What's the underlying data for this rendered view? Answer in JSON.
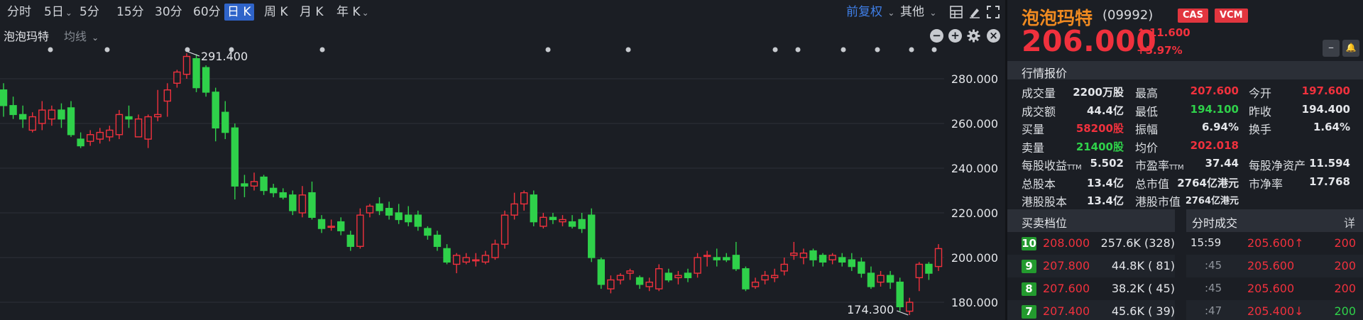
{
  "period_tabs": [
    {
      "label": "分时",
      "caret": ""
    },
    {
      "label": "5日",
      "caret": "⌄"
    },
    {
      "label": "5分",
      "caret": ""
    },
    {
      "label": "15分",
      "caret": ""
    },
    {
      "label": "30分",
      "caret": ""
    },
    {
      "label": "60分",
      "caret": ""
    },
    {
      "label": "日 K",
      "caret": ""
    },
    {
      "label": "周 K",
      "caret": ""
    },
    {
      "label": "月 K",
      "caret": ""
    },
    {
      "label": "年 K",
      "caret": "⌄"
    }
  ],
  "active_tab": "日 K",
  "adjust_label": "前复权",
  "other_label": "其他",
  "chart_stock_name": "泡泡玛特",
  "ma_label": "均线",
  "chart_controls": {
    "minus": "−",
    "plus": "+",
    "close": "×"
  },
  "colors": {
    "up": "#f0313d",
    "down": "#2fd14a",
    "accent": "#2f64c9",
    "name": "#f08a20",
    "background": "#1b1e24"
  },
  "chart_data": {
    "type": "candlestick",
    "y_ticks": [
      "280.000",
      "260.000",
      "240.000",
      "220.000",
      "200.000",
      "180.000"
    ],
    "ylim": [
      174,
      296
    ],
    "high_label": "291.400",
    "low_label": "174.300",
    "candles": [
      [
        275,
        268,
        278,
        263
      ],
      [
        268,
        264,
        272,
        262
      ],
      [
        264,
        262,
        268,
        258
      ],
      [
        257,
        263,
        265,
        256
      ],
      [
        260,
        266,
        270,
        257
      ],
      [
        262,
        266,
        268,
        259
      ],
      [
        266,
        262,
        269,
        258
      ],
      [
        267,
        255,
        270,
        254
      ],
      [
        253,
        250,
        256,
        249
      ],
      [
        252,
        255,
        257,
        250
      ],
      [
        253,
        256,
        258,
        251
      ],
      [
        254,
        257,
        259,
        252
      ],
      [
        255,
        264,
        266,
        253
      ],
      [
        263,
        262,
        268,
        258
      ],
      [
        254,
        262,
        264,
        256
      ],
      [
        253,
        263,
        264,
        249
      ],
      [
        263,
        264,
        275,
        261
      ],
      [
        270,
        275,
        278,
        263
      ],
      [
        278,
        283,
        284,
        276
      ],
      [
        282,
        290,
        291.4,
        280
      ],
      [
        289,
        276,
        291,
        274
      ],
      [
        285,
        274,
        286,
        272
      ],
      [
        274,
        258,
        276,
        252
      ],
      [
        265,
        256,
        270,
        253
      ],
      [
        258,
        232,
        260,
        226
      ],
      [
        233,
        232,
        237,
        227
      ],
      [
        232,
        234,
        238,
        230
      ],
      [
        236,
        230,
        237,
        228
      ],
      [
        231,
        229,
        233,
        227
      ],
      [
        229,
        227,
        231,
        226
      ],
      [
        228,
        221,
        230,
        219
      ],
      [
        220,
        228,
        232,
        218
      ],
      [
        229,
        218,
        234,
        217
      ],
      [
        217,
        213,
        219,
        211
      ],
      [
        214,
        214,
        217,
        212
      ],
      [
        216,
        212,
        218,
        210
      ],
      [
        210,
        205,
        212,
        203
      ],
      [
        205,
        219,
        222,
        204
      ],
      [
        220,
        223,
        224,
        218
      ],
      [
        224,
        221,
        227,
        219
      ],
      [
        222,
        219,
        225,
        217
      ],
      [
        220,
        217,
        224,
        215
      ],
      [
        219,
        216,
        223,
        214
      ],
      [
        219,
        214,
        221,
        212
      ],
      [
        213,
        210,
        214,
        208
      ],
      [
        210,
        205,
        212,
        203
      ],
      [
        204,
        198,
        206,
        197
      ],
      [
        197,
        201,
        202,
        193
      ],
      [
        198,
        200,
        202,
        197
      ],
      [
        199,
        199,
        202,
        196
      ],
      [
        198,
        201,
        203,
        197
      ],
      [
        200,
        206,
        208,
        199
      ],
      [
        206,
        219,
        221,
        204
      ],
      [
        219,
        224,
        229,
        217
      ],
      [
        224,
        229,
        230,
        221
      ],
      [
        228,
        216,
        230,
        214
      ],
      [
        214,
        218,
        220,
        213
      ],
      [
        218,
        217,
        220,
        215
      ],
      [
        216,
        217,
        219,
        214
      ],
      [
        216,
        214,
        219,
        213
      ],
      [
        217,
        213,
        220,
        211
      ],
      [
        219,
        200,
        222,
        198
      ],
      [
        199,
        188,
        200,
        186
      ],
      [
        186,
        190,
        192,
        184
      ],
      [
        190,
        192,
        193,
        188
      ],
      [
        193,
        194,
        195,
        190
      ],
      [
        191,
        188,
        192,
        186
      ],
      [
        187,
        189,
        191,
        185
      ],
      [
        186,
        195,
        197,
        185
      ],
      [
        193,
        190,
        195,
        189
      ],
      [
        191,
        192,
        194,
        188
      ],
      [
        193,
        191,
        195,
        189
      ],
      [
        193,
        200,
        202,
        191
      ],
      [
        201,
        201,
        203,
        196
      ],
      [
        200,
        199,
        204,
        196
      ],
      [
        200,
        199,
        202,
        198
      ],
      [
        201,
        195,
        207,
        194
      ],
      [
        195,
        186,
        196,
        185
      ],
      [
        187,
        189,
        191,
        186
      ],
      [
        190,
        192,
        194,
        188
      ],
      [
        191,
        192,
        195,
        189
      ],
      [
        194,
        197,
        200,
        192
      ],
      [
        201,
        202,
        207,
        199
      ],
      [
        200,
        202,
        204,
        197
      ],
      [
        203,
        199,
        204,
        196
      ],
      [
        201,
        198,
        202,
        196
      ],
      [
        199,
        201,
        202,
        197
      ],
      [
        200,
        198,
        202,
        196
      ],
      [
        199,
        196,
        202,
        194
      ],
      [
        198,
        193,
        200,
        191
      ],
      [
        193,
        187,
        196,
        186
      ],
      [
        189,
        192,
        194,
        187
      ],
      [
        192,
        189,
        194,
        186
      ],
      [
        189,
        178,
        191,
        176
      ],
      [
        176,
        180,
        182,
        174.3
      ],
      [
        191,
        197,
        198,
        185
      ],
      [
        197,
        193,
        198,
        190
      ],
      [
        196,
        204,
        206,
        194
      ]
    ]
  },
  "quote": {
    "name": "泡泡玛特",
    "code": "(09992)",
    "tags": [
      "CAS",
      "VCM"
    ],
    "price": "206.000",
    "change": "11.600",
    "change_pct": "+5.97%",
    "change_arrow": "↑",
    "minus_btn": "–",
    "bell_btn": "🔔"
  },
  "market_section_title": "行情报价",
  "market_rows": [
    [
      {
        "label": "成交量",
        "value": "2200万股",
        "color": ""
      },
      {
        "label": "最高",
        "value": "207.600",
        "color": "red"
      },
      {
        "label": "今开",
        "value": "197.600",
        "color": "red"
      }
    ],
    [
      {
        "label": "成交额",
        "value": "44.4亿",
        "color": ""
      },
      {
        "label": "最低",
        "value": "194.100",
        "color": "green"
      },
      {
        "label": "昨收",
        "value": "194.400",
        "color": ""
      }
    ],
    [
      {
        "label": "买量",
        "value": "58200股",
        "color": "red"
      },
      {
        "label": "振幅",
        "value": "6.94%",
        "color": ""
      },
      {
        "label": "换手",
        "value": "1.64%",
        "color": ""
      }
    ],
    [
      {
        "label": "卖量",
        "value": "21400股",
        "color": "green"
      },
      {
        "label": "均价",
        "value": "202.018",
        "color": "red"
      },
      {
        "label": "",
        "value": "",
        "color": ""
      }
    ],
    [
      {
        "label": "每股收益",
        "sub": "TTM",
        "value": "5.502",
        "color": ""
      },
      {
        "label": "市盈率",
        "sub": "TTM",
        "value": "37.44",
        "color": ""
      },
      {
        "label": "每股净资产",
        "value": "11.594",
        "color": ""
      }
    ],
    [
      {
        "label": "总股本",
        "value": "13.4亿",
        "color": ""
      },
      {
        "label": "总市值",
        "value": "2764亿港元",
        "color": ""
      },
      {
        "label": "市净率",
        "value": "17.768",
        "color": ""
      }
    ],
    [
      {
        "label": "港股股本",
        "value": "13.4亿",
        "color": ""
      },
      {
        "label": "港股市值",
        "value": "2764亿港元",
        "color": "",
        "small": true
      },
      {
        "label": "",
        "value": "",
        "color": ""
      }
    ]
  ],
  "book_title": "买卖档位",
  "trades_title": "分时成交",
  "trades_detail": "详",
  "book": [
    {
      "level": "10",
      "price": "208.000",
      "volume": "257.6K",
      "count": "(328)"
    },
    {
      "level": "9",
      "price": "207.800",
      "volume": "44.8K",
      "count": "( 81)"
    },
    {
      "level": "8",
      "price": "207.600",
      "volume": "38.2K",
      "count": "( 45)"
    },
    {
      "level": "7",
      "price": "207.400",
      "volume": "45.6K",
      "count": "( 39)"
    }
  ],
  "trades": [
    {
      "time": "15:59",
      "price": "205.600↑",
      "volume": "200",
      "color": "red",
      "dim": false
    },
    {
      "time": ":45",
      "price": "205.600",
      "volume": "200",
      "color": "red",
      "dim": true
    },
    {
      "time": ":45",
      "price": "205.600",
      "volume": "200",
      "color": "red",
      "dim": true
    },
    {
      "time": ":47",
      "price": "205.400↓",
      "volume": "200",
      "color": "red",
      "vol_color": "green",
      "dim": true
    }
  ]
}
